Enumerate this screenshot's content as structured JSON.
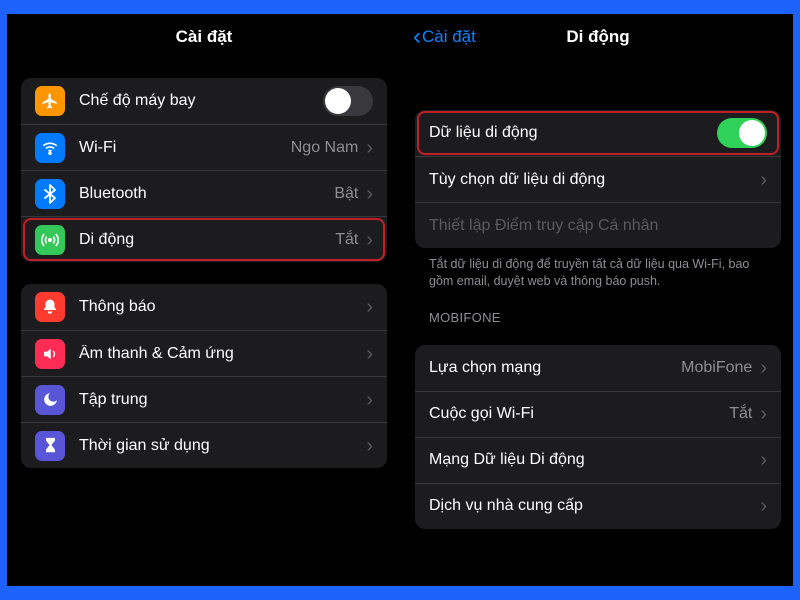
{
  "left": {
    "title": "Cài đặt",
    "group1": {
      "airplane": {
        "label": "Chế độ máy bay",
        "toggle": false
      },
      "wifi": {
        "label": "Wi-Fi",
        "value": "Ngo Nam"
      },
      "bluetooth": {
        "label": "Bluetooth",
        "value": "Bật"
      },
      "mobile": {
        "label": "Di động",
        "value": "Tắt"
      }
    },
    "group2": {
      "notifications": {
        "label": "Thông báo"
      },
      "sounds": {
        "label": "Âm thanh & Cảm ứng"
      },
      "focus": {
        "label": "Tập trung"
      },
      "screentime": {
        "label": "Thời gian sử dụng"
      }
    }
  },
  "right": {
    "back": "Cài đặt",
    "title": "Di động",
    "mobileData": {
      "label": "Dữ liệu di động",
      "toggle": true
    },
    "options": {
      "label": "Tùy chọn dữ liệu di động"
    },
    "hotspot": {
      "label": "Thiết lập Điểm truy cập Cá nhân"
    },
    "note": "Tắt dữ liệu di động để truyền tất cả dữ liệu qua Wi-Fi, bao gồm email, duyệt web và thông báo push.",
    "carrierHeader": "MOBIFONE",
    "network": {
      "label": "Lựa chọn mạng",
      "value": "MobiFone"
    },
    "wifiCall": {
      "label": "Cuộc gọi Wi-Fi",
      "value": "Tắt"
    },
    "dataNet": {
      "label": "Mạng Dữ liệu Di động"
    },
    "services": {
      "label": "Dịch vụ nhà cung cấp"
    }
  }
}
